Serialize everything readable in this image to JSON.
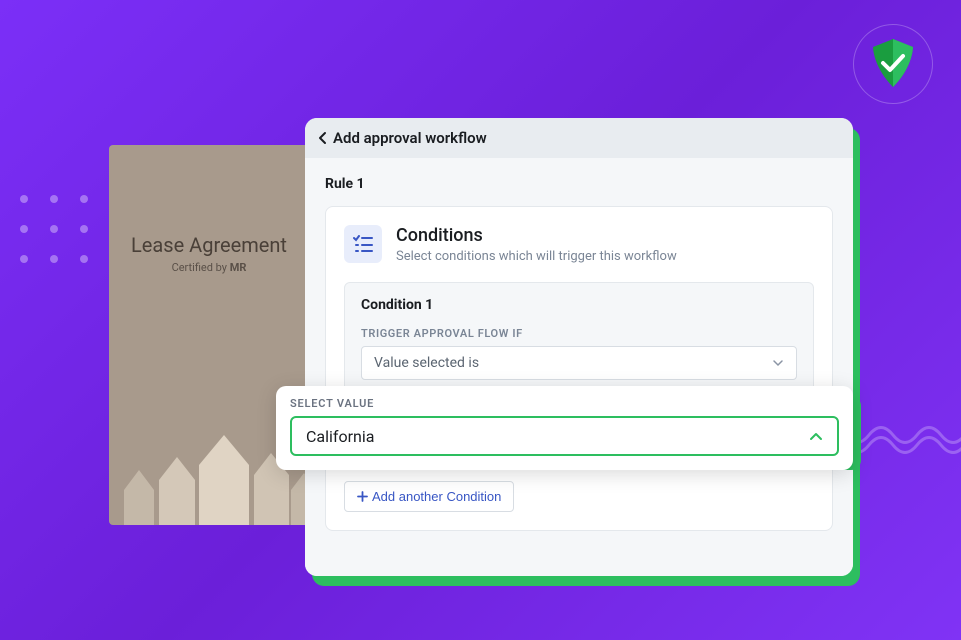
{
  "document": {
    "title": "Lease Agreement",
    "subtitle_prefix": "Certified by ",
    "subtitle_org": "MR"
  },
  "modal": {
    "header_title": "Add approval workflow",
    "rule_title": "Rule 1",
    "conditions_title": "Conditions",
    "conditions_subtitle": "Select conditions which will trigger this workflow",
    "condition_block_label": "Condition 1",
    "trigger_label": "TRIGGER APPROVAL FLOW IF",
    "trigger_selected": "Value selected is",
    "add_condition_label": "Add another Condition"
  },
  "popup": {
    "label": "SELECT VALUE",
    "value": "California"
  },
  "colors": {
    "accent_green": "#2dbe5f",
    "primary_blue": "#3856c4",
    "background_purple": "#7b2ff7"
  }
}
